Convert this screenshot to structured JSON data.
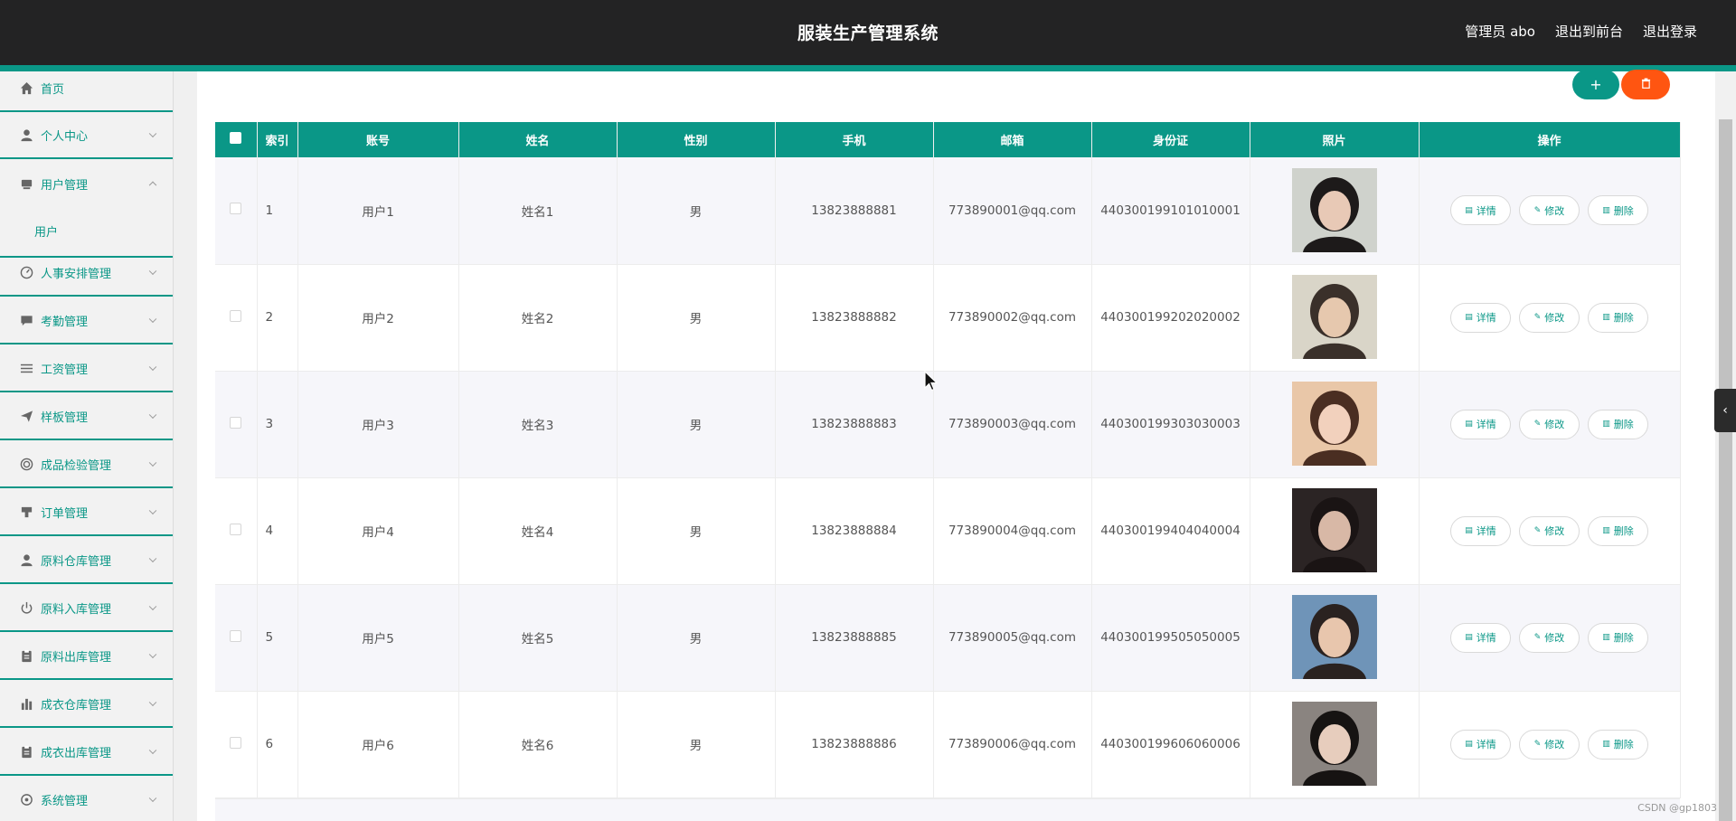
{
  "header": {
    "title": "服装生产管理系统",
    "links": [
      "管理员 abo",
      "退出到前台",
      "退出登录"
    ]
  },
  "sidebar": {
    "items": [
      {
        "label": "首页",
        "icon": "home-icon"
      },
      {
        "label": "个人中心",
        "icon": "user-icon"
      },
      {
        "label": "用户管理",
        "icon": "box-icon",
        "expanded": true
      },
      {
        "label": "人事安排管理",
        "icon": "gauge-icon"
      },
      {
        "label": "考勤管理",
        "icon": "chat-icon"
      },
      {
        "label": "工资管理",
        "icon": "list-icon"
      },
      {
        "label": "样板管理",
        "icon": "send-icon"
      },
      {
        "label": "成品检验管理",
        "icon": "ring-icon"
      },
      {
        "label": "订单管理",
        "icon": "stamp-icon"
      },
      {
        "label": "原料仓库管理",
        "icon": "user-icon"
      },
      {
        "label": "原料入库管理",
        "icon": "power-icon"
      },
      {
        "label": "原料出库管理",
        "icon": "clipboard-icon"
      },
      {
        "label": "成衣仓库管理",
        "icon": "chart-icon"
      },
      {
        "label": "成衣出库管理",
        "icon": "clipboard-icon"
      },
      {
        "label": "系统管理",
        "icon": "gear-icon"
      }
    ],
    "sub_item": "用户"
  },
  "toolbar": {
    "add_label": "+",
    "delete_icon": "trash-icon"
  },
  "table": {
    "columns": [
      "",
      "索引",
      "账号",
      "姓名",
      "性别",
      "手机",
      "邮箱",
      "身份证",
      "照片",
      "操作"
    ],
    "rows": [
      {
        "index": "1",
        "account": "用户1",
        "name": "姓名1",
        "gender": "男",
        "phone": "13823888881",
        "email": "773890001@qq.com",
        "id_card": "440300199101010001"
      },
      {
        "index": "2",
        "account": "用户2",
        "name": "姓名2",
        "gender": "男",
        "phone": "13823888882",
        "email": "773890002@qq.com",
        "id_card": "440300199202020002"
      },
      {
        "index": "3",
        "account": "用户3",
        "name": "姓名3",
        "gender": "男",
        "phone": "13823888883",
        "email": "773890003@qq.com",
        "id_card": "440300199303030003"
      },
      {
        "index": "4",
        "account": "用户4",
        "name": "姓名4",
        "gender": "男",
        "phone": "13823888884",
        "email": "773890004@qq.com",
        "id_card": "440300199404040004"
      },
      {
        "index": "5",
        "account": "用户5",
        "name": "姓名5",
        "gender": "男",
        "phone": "13823888885",
        "email": "773890005@qq.com",
        "id_card": "440300199505050005"
      },
      {
        "index": "6",
        "account": "用户6",
        "name": "姓名6",
        "gender": "男",
        "phone": "13823888886",
        "email": "773890006@qq.com",
        "id_card": "440300199606060006"
      }
    ],
    "actions": {
      "detail": "详情",
      "edit": "修改",
      "delete": "删除"
    }
  },
  "watermark": "CSDN @gp1803",
  "colors": {
    "accent": "#0a9787",
    "danger": "#ff5511",
    "topbar": "#232324"
  }
}
